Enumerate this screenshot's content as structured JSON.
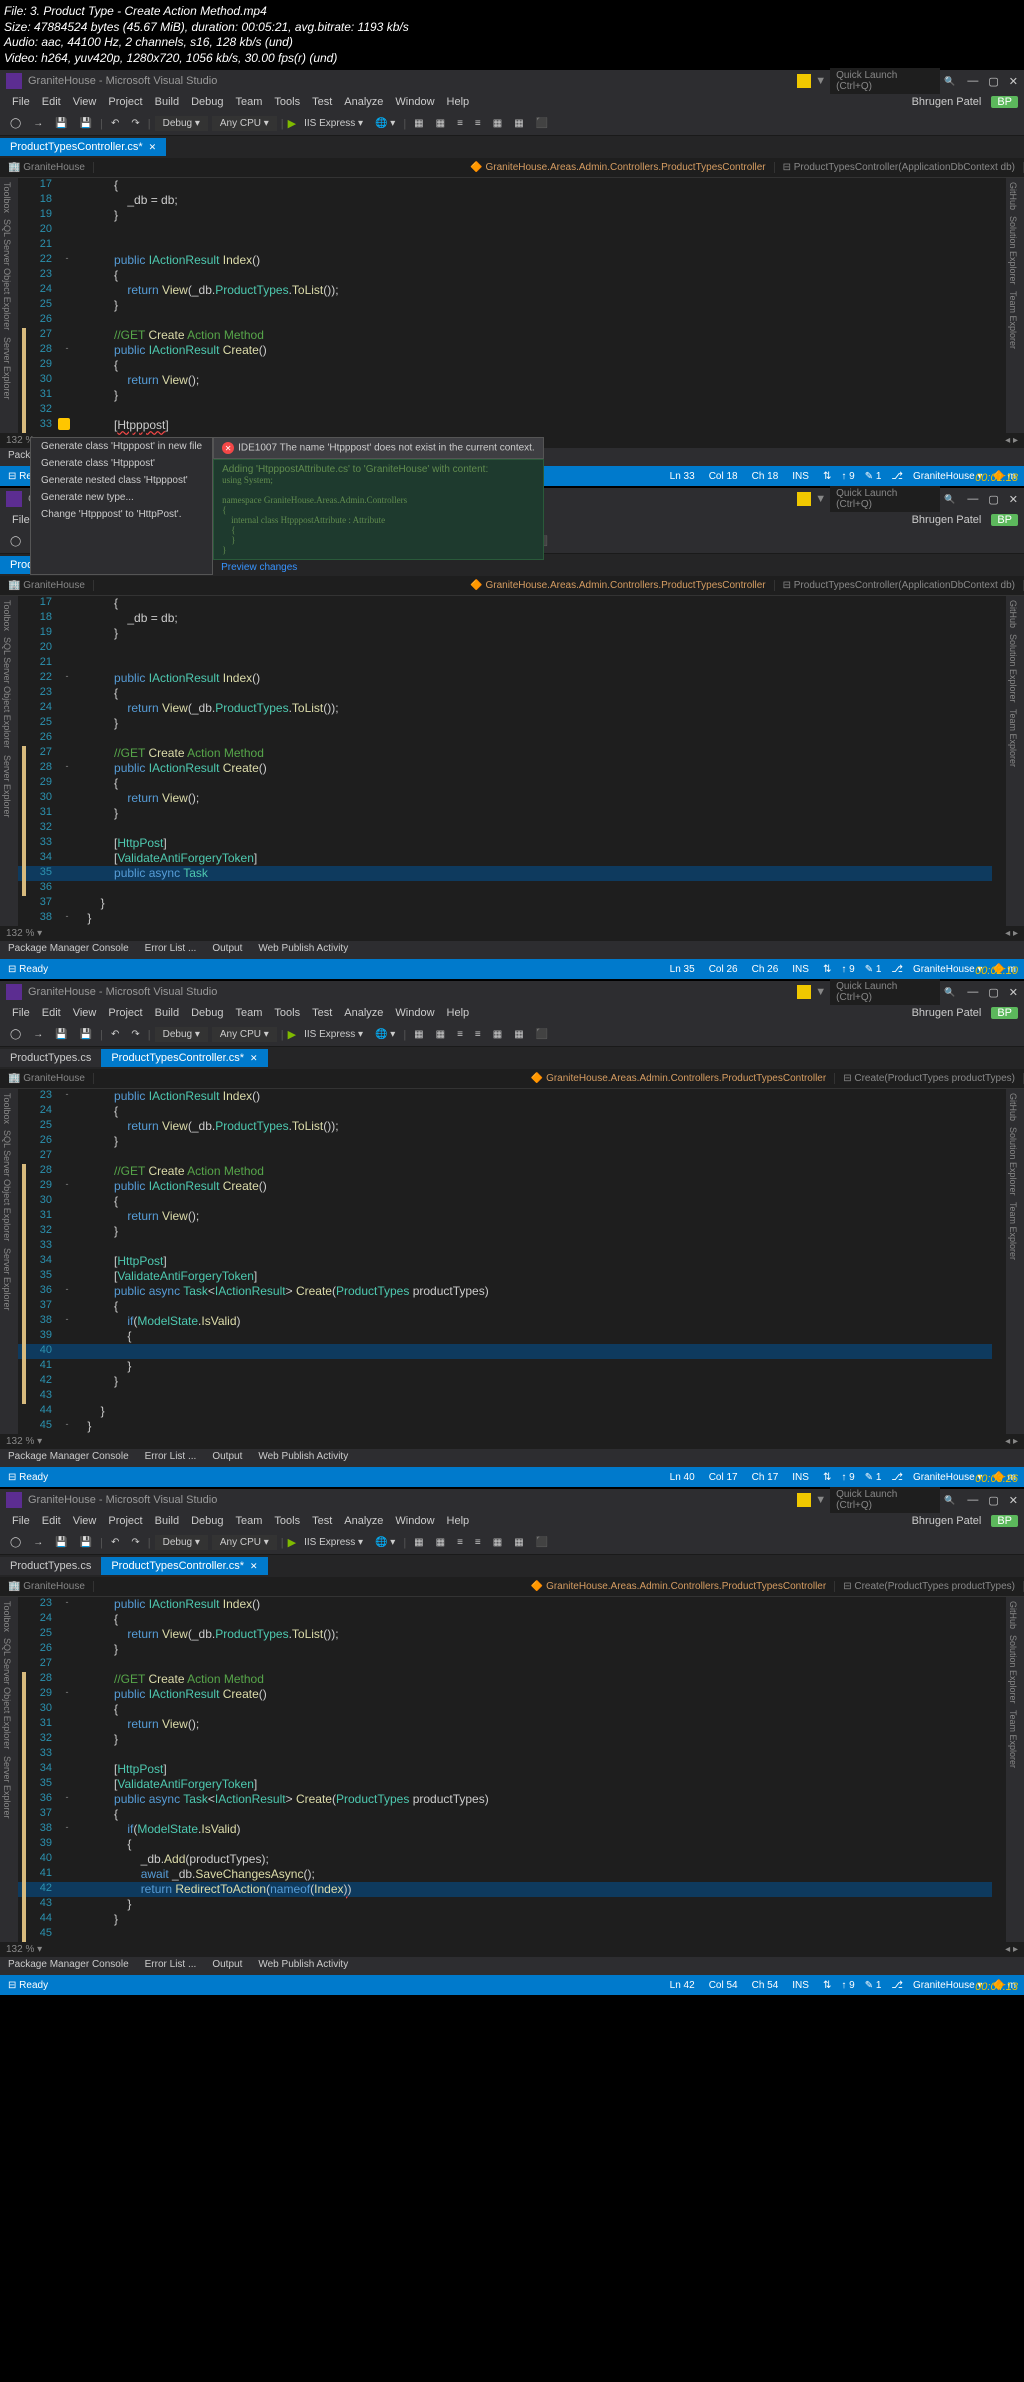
{
  "meta": {
    "l1": "File: 3. Product Type - Create Action Method.mp4",
    "l2": "Size: 47884524 bytes (45.67 MiB), duration: 00:05:21, avg.bitrate: 1193 kb/s",
    "l3": "Audio: aac, 44100 Hz, 2 channels, s16, 128 kb/s (und)",
    "l4": "Video: h264, yuv420p, 1280x720, 1056 kb/s, 30.00 fps(r) (und)"
  },
  "vs": {
    "title": "GraniteHouse - Microsoft Visual Studio",
    "user": "Bhrugen Patel",
    "ql": "Quick Launch (Ctrl+Q)",
    "menus": [
      "File",
      "Edit",
      "View",
      "Project",
      "Build",
      "Debug",
      "Team",
      "Tools",
      "Test",
      "Analyze",
      "Window",
      "Help"
    ],
    "toolbar": {
      "config": "Debug",
      "platform": "Any CPU",
      "run": "IIS Express"
    },
    "output_tabs": [
      "Package Manager Console",
      "Error List ...",
      "Output",
      "Web Publish Activity"
    ],
    "zoom": "132 %",
    "left_tools": [
      "Toolbox",
      "SQL Server Object Explorer",
      "Server Explorer"
    ],
    "right_tools": [
      "GitHub",
      "Solution Explorer",
      "Team Explorer"
    ]
  },
  "frames": [
    {
      "ts": "00:01:18",
      "tabs": [
        {
          "n": "ProductTypesController.cs*",
          "active": true,
          "pinned": true
        }
      ],
      "ctx": {
        "ns": "GraniteHouse",
        "cls": "GraniteHouse.Areas.Admin.Controllers.ProductTypesController",
        "mth": "ProductTypesController(ApplicationDbContext db)"
      },
      "lines": [
        {
          "n": 17,
          "c": "            {"
        },
        {
          "n": 18,
          "c": "                _db = db;"
        },
        {
          "n": 19,
          "c": "            }"
        },
        {
          "n": 20,
          "c": ""
        },
        {
          "n": 21,
          "c": ""
        },
        {
          "n": 22,
          "c": "            public IActionResult Index()",
          "f": "-"
        },
        {
          "n": 23,
          "c": "            {"
        },
        {
          "n": 24,
          "c": "                return View(_db.ProductTypes.ToList());"
        },
        {
          "n": 25,
          "c": "            }"
        },
        {
          "n": 26,
          "c": ""
        },
        {
          "n": 27,
          "c": "            //GET Create Action Method",
          "y": true
        },
        {
          "n": 28,
          "c": "            public IActionResult Create()",
          "y": true,
          "f": "-"
        },
        {
          "n": 29,
          "c": "            {",
          "y": true
        },
        {
          "n": 30,
          "c": "                return View();",
          "y": true
        },
        {
          "n": 31,
          "c": "            }",
          "y": true
        },
        {
          "n": 32,
          "c": "",
          "y": true
        },
        {
          "n": 33,
          "c": "            [Htpppost]",
          "y": true,
          "err": "Htpppost"
        }
      ],
      "quickactions": {
        "items": [
          "Generate class 'Htpppost' in new file",
          "Generate class 'Htpppost'",
          "Generate nested class 'Htpppost'",
          "Generate new type...",
          "Change 'Htpppost' to 'HttpPost'."
        ],
        "tooltip": {
          "id": "IDE1007",
          "msg": "The name 'Htpppost' does not exist in the current context."
        },
        "preview": {
          "hdr": "Adding 'HtpppostAttribute.cs' to 'GraniteHouse' with content:",
          "code": "using System;\n\nnamespace GraniteHouse.Areas.Admin.Controllers\n{\n    internal class HtpppostAttribute : Attribute\n    {\n    }\n}",
          "link": "Preview changes"
        }
      },
      "status": {
        "ready": "Ready",
        "ln": "Ln 33",
        "col": "Col 18",
        "ch": "Ch 18",
        "ins": "INS",
        "branch": "GraniteHouse",
        "up": "9",
        "down": "1",
        "m": "m"
      }
    },
    {
      "ts": "00:02:10",
      "tabs": [
        {
          "n": "ProductTypesController.cs*",
          "active": true,
          "pinned": true
        }
      ],
      "ctx": {
        "ns": "GraniteHouse",
        "cls": "GraniteHouse.Areas.Admin.Controllers.ProductTypesController",
        "mth": "ProductTypesController(ApplicationDbContext db)"
      },
      "lines": [
        {
          "n": 17,
          "c": "            {"
        },
        {
          "n": 18,
          "c": "                _db = db;"
        },
        {
          "n": 19,
          "c": "            }"
        },
        {
          "n": 20,
          "c": ""
        },
        {
          "n": 21,
          "c": ""
        },
        {
          "n": 22,
          "c": "            public IActionResult Index()",
          "f": "-"
        },
        {
          "n": 23,
          "c": "            {"
        },
        {
          "n": 24,
          "c": "                return View(_db.ProductTypes.ToList());"
        },
        {
          "n": 25,
          "c": "            }"
        },
        {
          "n": 26,
          "c": ""
        },
        {
          "n": 27,
          "c": "            //GET Create Action Method",
          "y": true
        },
        {
          "n": 28,
          "c": "            public IActionResult Create()",
          "y": true,
          "f": "-"
        },
        {
          "n": 29,
          "c": "            {",
          "y": true
        },
        {
          "n": 30,
          "c": "                return View();",
          "y": true
        },
        {
          "n": 31,
          "c": "            }",
          "y": true
        },
        {
          "n": 32,
          "c": "",
          "y": true
        },
        {
          "n": 33,
          "c": "            [HttpPost]",
          "y": true
        },
        {
          "n": 34,
          "c": "            [ValidateAntiForgeryToken]",
          "y": true
        },
        {
          "n": 35,
          "c": "            public async Task",
          "y": true,
          "hl": true
        },
        {
          "n": 36,
          "c": "",
          "y": true
        },
        {
          "n": 37,
          "c": "        }"
        },
        {
          "n": 38,
          "c": "    }",
          "f": "-"
        }
      ],
      "status": {
        "ready": "Ready",
        "ln": "Ln 35",
        "col": "Col 26",
        "ch": "Ch 26",
        "ins": "INS",
        "branch": "GraniteHouse",
        "up": "9",
        "down": "1",
        "m": "m"
      }
    },
    {
      "ts": "00:03:26",
      "tabs": [
        {
          "n": "ProductTypes.cs",
          "active": false
        },
        {
          "n": "ProductTypesController.cs*",
          "active": true,
          "pinned": true
        }
      ],
      "ctx": {
        "ns": "GraniteHouse",
        "cls": "GraniteHouse.Areas.Admin.Controllers.ProductTypesController",
        "mth": "Create(ProductTypes productTypes)"
      },
      "lines": [
        {
          "n": 23,
          "c": "            public IActionResult Index()",
          "f": "-"
        },
        {
          "n": 24,
          "c": "            {"
        },
        {
          "n": 25,
          "c": "                return View(_db.ProductTypes.ToList());"
        },
        {
          "n": 26,
          "c": "            }"
        },
        {
          "n": 27,
          "c": ""
        },
        {
          "n": 28,
          "c": "            //GET Create Action Method",
          "y": true
        },
        {
          "n": 29,
          "c": "            public IActionResult Create()",
          "y": true,
          "f": "-"
        },
        {
          "n": 30,
          "c": "            {",
          "y": true
        },
        {
          "n": 31,
          "c": "                return View();",
          "y": true
        },
        {
          "n": 32,
          "c": "            }",
          "y": true
        },
        {
          "n": 33,
          "c": "",
          "y": true
        },
        {
          "n": 34,
          "c": "            [HttpPost]",
          "y": true
        },
        {
          "n": 35,
          "c": "            [ValidateAntiForgeryToken]",
          "y": true
        },
        {
          "n": 36,
          "c": "            public async Task<IActionResult> Create(ProductTypes productTypes)",
          "y": true,
          "f": "-"
        },
        {
          "n": 37,
          "c": "            {",
          "y": true
        },
        {
          "n": 38,
          "c": "                if(ModelState.IsValid)",
          "y": true,
          "f": "-"
        },
        {
          "n": 39,
          "c": "                {",
          "y": true
        },
        {
          "n": 40,
          "c": "",
          "y": true,
          "hl": true
        },
        {
          "n": 41,
          "c": "                }",
          "y": true
        },
        {
          "n": 42,
          "c": "            }",
          "y": true
        },
        {
          "n": 43,
          "c": "",
          "y": true
        },
        {
          "n": 44,
          "c": "        }"
        },
        {
          "n": 45,
          "c": "    }",
          "f": "-"
        }
      ],
      "status": {
        "ready": "Ready",
        "ln": "Ln 40",
        "col": "Col 17",
        "ch": "Ch 17",
        "ins": "INS",
        "branch": "GraniteHouse",
        "up": "9",
        "down": "1",
        "m": "m"
      }
    },
    {
      "ts": "00:04:13",
      "tabs": [
        {
          "n": "ProductTypes.cs",
          "active": false
        },
        {
          "n": "ProductTypesController.cs*",
          "active": true,
          "pinned": true
        }
      ],
      "ctx": {
        "ns": "GraniteHouse",
        "cls": "GraniteHouse.Areas.Admin.Controllers.ProductTypesController",
        "mth": "Create(ProductTypes productTypes)"
      },
      "lines": [
        {
          "n": 23,
          "c": "            public IActionResult Index()",
          "f": "-"
        },
        {
          "n": 24,
          "c": "            {"
        },
        {
          "n": 25,
          "c": "                return View(_db.ProductTypes.ToList());"
        },
        {
          "n": 26,
          "c": "            }"
        },
        {
          "n": 27,
          "c": ""
        },
        {
          "n": 28,
          "c": "            //GET Create Action Method",
          "y": true
        },
        {
          "n": 29,
          "c": "            public IActionResult Create()",
          "y": true,
          "f": "-"
        },
        {
          "n": 30,
          "c": "            {",
          "y": true
        },
        {
          "n": 31,
          "c": "                return View();",
          "y": true
        },
        {
          "n": 32,
          "c": "            }",
          "y": true
        },
        {
          "n": 33,
          "c": "",
          "y": true
        },
        {
          "n": 34,
          "c": "            [HttpPost]",
          "y": true
        },
        {
          "n": 35,
          "c": "            [ValidateAntiForgeryToken]",
          "y": true
        },
        {
          "n": 36,
          "c": "            public async Task<IActionResult> Create(ProductTypes productTypes)",
          "y": true,
          "f": "-"
        },
        {
          "n": 37,
          "c": "            {",
          "y": true
        },
        {
          "n": 38,
          "c": "                if(ModelState.IsValid)",
          "y": true,
          "f": "-"
        },
        {
          "n": 39,
          "c": "                {",
          "y": true
        },
        {
          "n": 40,
          "c": "                    _db.Add(productTypes);",
          "y": true
        },
        {
          "n": 41,
          "c": "                    await _db.SaveChangesAsync();",
          "y": true
        },
        {
          "n": 42,
          "c": "                    return RedirectToAction(nameof(Index))",
          "y": true,
          "hl": true,
          "err": ")"
        },
        {
          "n": 43,
          "c": "                }",
          "y": true
        },
        {
          "n": 44,
          "c": "            }",
          "y": true
        },
        {
          "n": 45,
          "c": "",
          "y": true
        }
      ],
      "status": {
        "ready": "Ready",
        "ln": "Ln 42",
        "col": "Col 54",
        "ch": "Ch 54",
        "ins": "INS",
        "branch": "GraniteHouse",
        "up": "9",
        "down": "1",
        "m": "m"
      }
    }
  ]
}
